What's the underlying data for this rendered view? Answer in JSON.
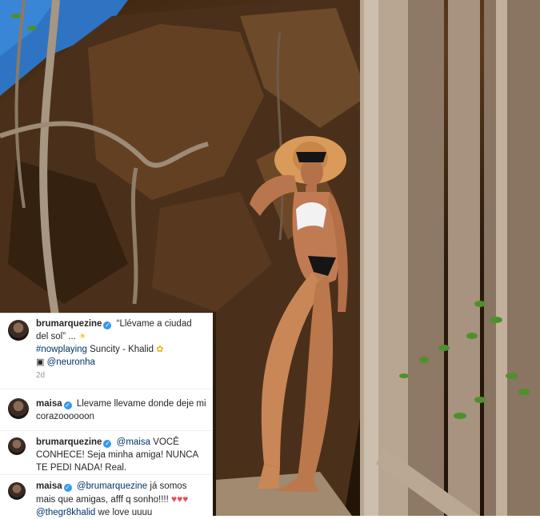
{
  "post": {
    "image_alt": "woman in sun hat and bikini posing among tree roots on a rock face",
    "caption": {
      "username": "brumarquezine",
      "line1": "“Llévame a ciudad del sol” ...",
      "hashtag": "#nowplaying",
      "song": "Suncity - Khalid",
      "mention": "@neuronha",
      "time": "2d"
    },
    "comments": [
      {
        "username": "maisa",
        "text": "Llevame llevame donde deje mi corazoooooon"
      },
      {
        "username": "brumarquezine",
        "mention": "@maisa",
        "text": "VOCÊ CONHECE! Seja minha amiga! NUNCA TE PEDI NADA! Real."
      },
      {
        "username": "maisa",
        "mention": "@brumarquezine",
        "text": "já somos mais que amigas, afff q sonho!!!!",
        "mention2": "@thegr8khalid",
        "text2": "we love uuuu"
      }
    ]
  },
  "icons": {
    "sun": "sun-icon",
    "sunflower": "sunflower-icon",
    "camera": "camera-icon",
    "verified": "verified-badge-icon",
    "heart": "heart-icon"
  },
  "colors": {
    "verified": "#3897f0",
    "link": "#003569",
    "heart": "#ed4956",
    "muted": "#999999"
  }
}
